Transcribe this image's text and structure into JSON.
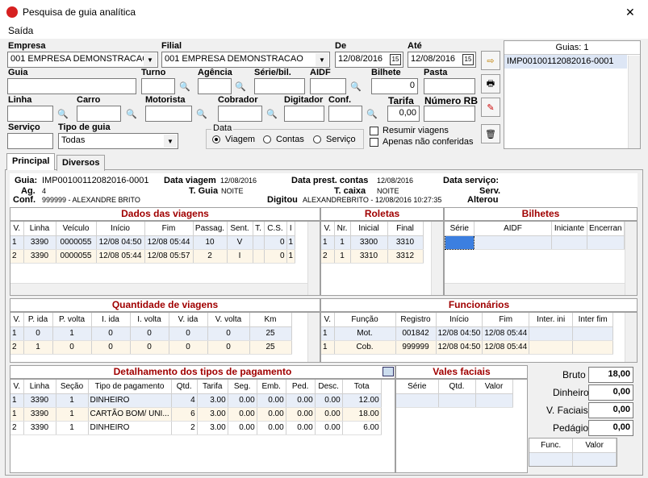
{
  "window": {
    "title": "Pesquisa de guia analítica",
    "close": "✕",
    "menu": "Saída"
  },
  "filters": {
    "empresa_label": "Empresa",
    "empresa_value": "001 EMPRESA DEMONSTRACAO",
    "filial_label": "Filial",
    "filial_value": "001 EMPRESA DEMONSTRACAO",
    "de_label": "De",
    "de_value": "12/08/2016",
    "ate_label": "Até",
    "ate_value": "12/08/2016",
    "cal": "15",
    "guia_label": "Guia",
    "turno_label": "Turno",
    "agencia_label": "Agência",
    "serie_label": "Série/bil.",
    "aidf_label": "AIDF",
    "bilhete_label": "Bilhete",
    "bilhete_value": "0",
    "pasta_label": "Pasta",
    "linha_label": "Linha",
    "carro_label": "Carro",
    "motorista_label": "Motorista",
    "cobrador_label": "Cobrador",
    "digitador_label": "Digitador",
    "conf_label": "Conf.",
    "tarifa_label": "Tarifa",
    "tarifa_value": "0,00",
    "numero_rb_label": "Número RB",
    "servico_label": "Serviço",
    "tipo_guia_label": "Tipo de guia",
    "tipo_guia_value": "Todas",
    "data_group_label": "Data",
    "data_options": [
      "Viagem",
      "Contas",
      "Serviço"
    ],
    "resumir_label": "Resumir viagens",
    "nao_conferidas_label": "Apenas não conferidas"
  },
  "guias_panel": {
    "header": "Guias: 1",
    "items": [
      "IMP00100112082016-0001"
    ]
  },
  "tabs": [
    "Principal",
    "Diversos"
  ],
  "info": {
    "guia_label": "Guia:",
    "guia_value": "IMP00100112082016-0001",
    "data_viagem_label": "Data viagem",
    "data_viagem_value": "12/08/2016",
    "data_prest_label": "Data prest. contas",
    "data_prest_value": "12/08/2016",
    "data_servico_label": "Data serviço:",
    "ag_label": "Ag.",
    "ag_value": "4",
    "tguia_label": "T. Guia",
    "tguia_value": "NOITE",
    "tcaixa_label": "T. caixa",
    "tcaixa_value": "NOITE",
    "serv_label": "Serv.",
    "conf_label": "Conf.",
    "conf_value": "999999 - ALEXANDRE BRITO",
    "digitou_label": "Digitou",
    "digitou_value": "ALEXANDREBRITO - 12/08/2016 10:27:35",
    "alterou_label": "Alterou"
  },
  "viagens": {
    "title": "Dados das viagens",
    "cols": [
      "V.",
      "Linha",
      "Veículo",
      "Início",
      "Fim",
      "Passag.",
      "Sent.",
      "T.",
      "C.S.",
      "I"
    ],
    "rows": [
      [
        "1",
        "3390",
        "0000055",
        "12/08 04:50",
        "12/08 05:44",
        "10",
        "V",
        "",
        "0",
        "1"
      ],
      [
        "2",
        "3390",
        "0000055",
        "12/08 05:44",
        "12/08 05:57",
        "2",
        "I",
        "",
        "0",
        "1"
      ]
    ]
  },
  "roletas": {
    "title": "Roletas",
    "cols": [
      "V.",
      "Nr.",
      "Inicial",
      "Final"
    ],
    "rows": [
      [
        "1",
        "1",
        "3300",
        "3310"
      ],
      [
        "2",
        "1",
        "3310",
        "3312"
      ]
    ]
  },
  "bilhetes": {
    "title": "Bilhetes",
    "cols": [
      "Série",
      "AIDF",
      "Iniciante",
      "Encerran"
    ]
  },
  "qtd_viagens": {
    "title": "Quantidade de viagens",
    "cols": [
      "V.",
      "P. ida",
      "P. volta",
      "I. ida",
      "I. volta",
      "V. ida",
      "V. volta",
      "Km"
    ],
    "rows": [
      [
        "1",
        "0",
        "1",
        "0",
        "0",
        "0",
        "0",
        "25"
      ],
      [
        "2",
        "1",
        "0",
        "0",
        "0",
        "0",
        "0",
        "25"
      ]
    ]
  },
  "funcionarios": {
    "title": "Funcionários",
    "cols": [
      "V.",
      "Função",
      "Registro",
      "Início",
      "Fim",
      "Inter. ini",
      "Inter fim"
    ],
    "rows": [
      [
        "1",
        "Mot.",
        "001842",
        "12/08 04:50",
        "12/08 05:44",
        "",
        ""
      ],
      [
        "1",
        "Cob.",
        "999999",
        "12/08 04:50",
        "12/08 05:44",
        "",
        ""
      ]
    ]
  },
  "pagamento": {
    "title": "Detalhamento dos tipos de pagamento",
    "cols": [
      "V.",
      "Linha",
      "Seção",
      "Tipo de pagamento",
      "Qtd.",
      "Tarifa",
      "Seg.",
      "Emb.",
      "Ped.",
      "Desc.",
      "Tota"
    ],
    "rows": [
      [
        "1",
        "3390",
        "1",
        "DINHEIRO",
        "4",
        "3.00",
        "0.00",
        "0.00",
        "0.00",
        "0.00",
        "12.00"
      ],
      [
        "1",
        "3390",
        "1",
        "CARTÃO BOM/ UNI...",
        "6",
        "3.00",
        "0.00",
        "0.00",
        "0.00",
        "0.00",
        "18.00"
      ],
      [
        "2",
        "3390",
        "1",
        "DINHEIRO",
        "2",
        "3.00",
        "0.00",
        "0.00",
        "0.00",
        "0.00",
        "6.00"
      ]
    ]
  },
  "vales": {
    "title": "Vales faciais",
    "cols": [
      "Série",
      "Qtd.",
      "Valor"
    ]
  },
  "totais": {
    "bruto_label": "Bruto",
    "bruto_value": "18,00",
    "dinheiro_label": "Dinheiro",
    "dinheiro_value": "0,00",
    "vfaciais_label": "V. Faciais",
    "vfaciais_value": "0,00",
    "pedagio_label": "Pedágio",
    "pedagio_value": "0,00",
    "cols": [
      "Func.",
      "Valor"
    ]
  }
}
